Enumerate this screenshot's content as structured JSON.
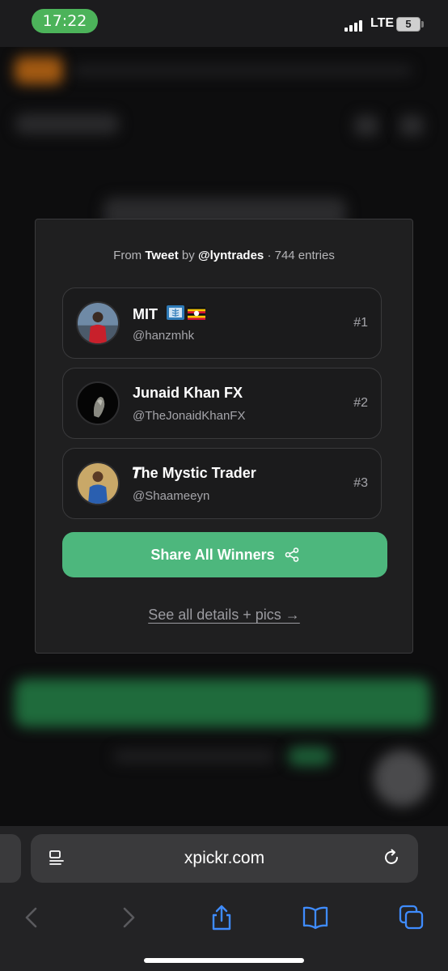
{
  "status_bar": {
    "time": "17:22",
    "network": "LTE",
    "battery": "5"
  },
  "card": {
    "header": {
      "from": "From",
      "source": "Tweet",
      "by": "by",
      "author": "@lyntrades",
      "entries": "· 744 entries"
    },
    "winners": [
      {
        "name": "MIT",
        "handle": "@hanzmhk",
        "rank": "#1"
      },
      {
        "name": "Junaid Khan FX",
        "handle": "@TheJonaidKhanFX",
        "rank": "#2"
      },
      {
        "name": "𝑻he Mystic Trader",
        "handle": "@Shaameeyn",
        "rank": "#3"
      }
    ],
    "share_label": "Share All Winners",
    "see_all_label": "See all details + pics →"
  },
  "browser": {
    "url": "xpickr.com"
  },
  "colors": {
    "accent_green": "#4db77d",
    "time_pill": "#4cb35a"
  }
}
